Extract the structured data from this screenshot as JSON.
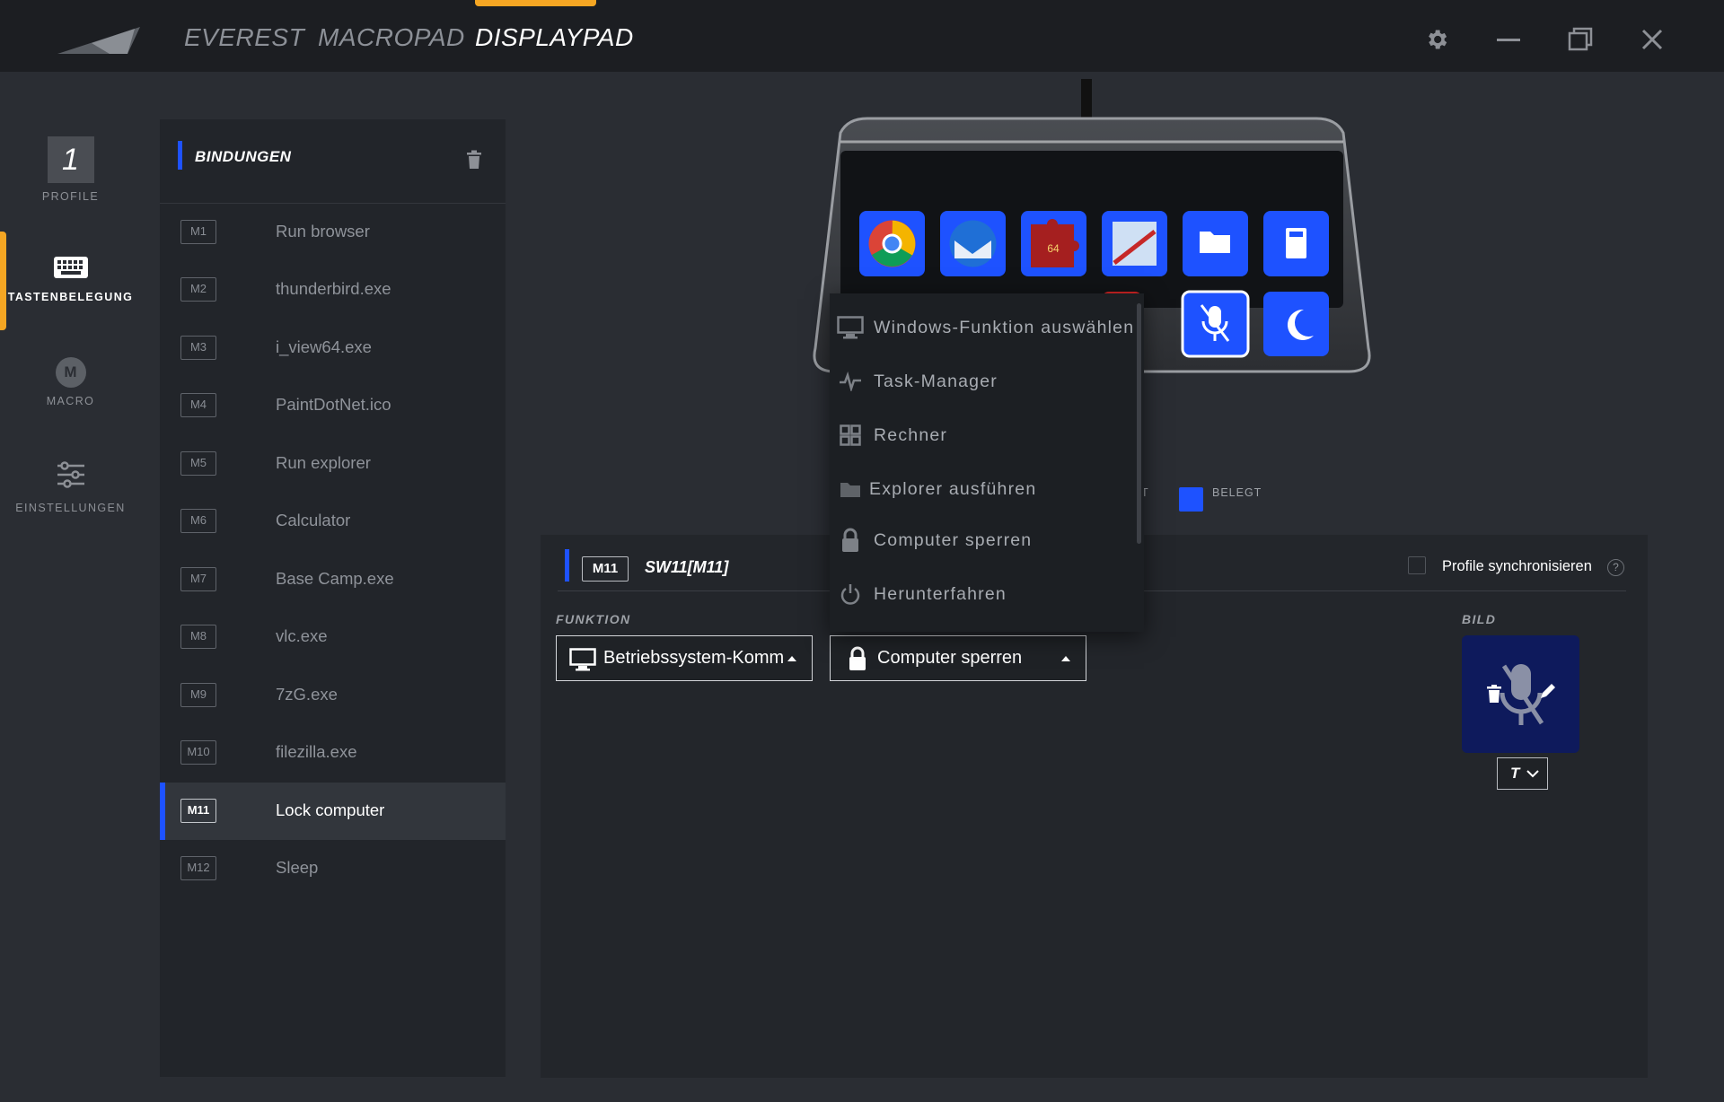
{
  "topbar": {
    "tabs": [
      {
        "label": "EVEREST"
      },
      {
        "label": "MACROPAD"
      },
      {
        "label": "DISPLAYPAD"
      }
    ],
    "active_tab": "DISPLAYPAD",
    "accent_color": "#f5a623"
  },
  "sidebar": {
    "profile_number": "1",
    "items": [
      {
        "label": "PROFILE",
        "icon": "profile-number-box"
      },
      {
        "label": "TASTENBELEGUNG",
        "icon": "keyboard-icon"
      },
      {
        "label": "MACRO",
        "icon": "macro-icon",
        "glyph": "M"
      },
      {
        "label": "EINSTELLUNGEN",
        "icon": "sliders-icon"
      }
    ],
    "active": "TASTENBELEGUNG"
  },
  "bindings": {
    "title": "BINDUNGEN",
    "rows": [
      {
        "key": "M1",
        "name": "Run browser"
      },
      {
        "key": "M2",
        "name": "thunderbird.exe"
      },
      {
        "key": "M3",
        "name": "i_view64.exe"
      },
      {
        "key": "M4",
        "name": "PaintDotNet.ico"
      },
      {
        "key": "M5",
        "name": "Run explorer"
      },
      {
        "key": "M6",
        "name": "Calculator"
      },
      {
        "key": "M7",
        "name": "Base Camp.exe"
      },
      {
        "key": "M8",
        "name": "vlc.exe"
      },
      {
        "key": "M9",
        "name": "7zG.exe"
      },
      {
        "key": "M10",
        "name": "filezilla.exe"
      },
      {
        "key": "M11",
        "name": "Lock computer"
      },
      {
        "key": "M12",
        "name": "Sleep"
      }
    ],
    "selected_key": "M11"
  },
  "device": {
    "keys_row1": [
      "chrome-icon",
      "thunderbird-icon",
      "puzzle-icon",
      "paint-icon",
      "folder-icon",
      "calculator-icon"
    ],
    "keys_row2_visible": [
      "red-app-icon",
      "mic-off-icon",
      "moon-icon"
    ],
    "legend_partial": "T",
    "legend_label": "BELEGT",
    "legend_color": "#1e52ff"
  },
  "detail": {
    "key": "M11",
    "title": "SW11[M11]",
    "sync_label": "Profile synchronisieren",
    "sync_checked": false,
    "help": "?",
    "function_label": "FUNKTION",
    "select_category": "Betriebssystem-Komm",
    "select_action": "Computer sperren",
    "image_label": "BILD",
    "text_button": "T"
  },
  "dropdown": {
    "items": [
      {
        "label": "Windows-Funktion auswählen",
        "icon": "monitor-icon"
      },
      {
        "label": "Task-Manager",
        "icon": "pulse-icon"
      },
      {
        "label": "Rechner",
        "icon": "grid-calculator-icon"
      },
      {
        "label": "Explorer ausführen",
        "icon": "folder-icon"
      },
      {
        "label": "Computer sperren",
        "icon": "lock-icon"
      },
      {
        "label": "Herunterfahren",
        "icon": "power-icon"
      }
    ]
  }
}
